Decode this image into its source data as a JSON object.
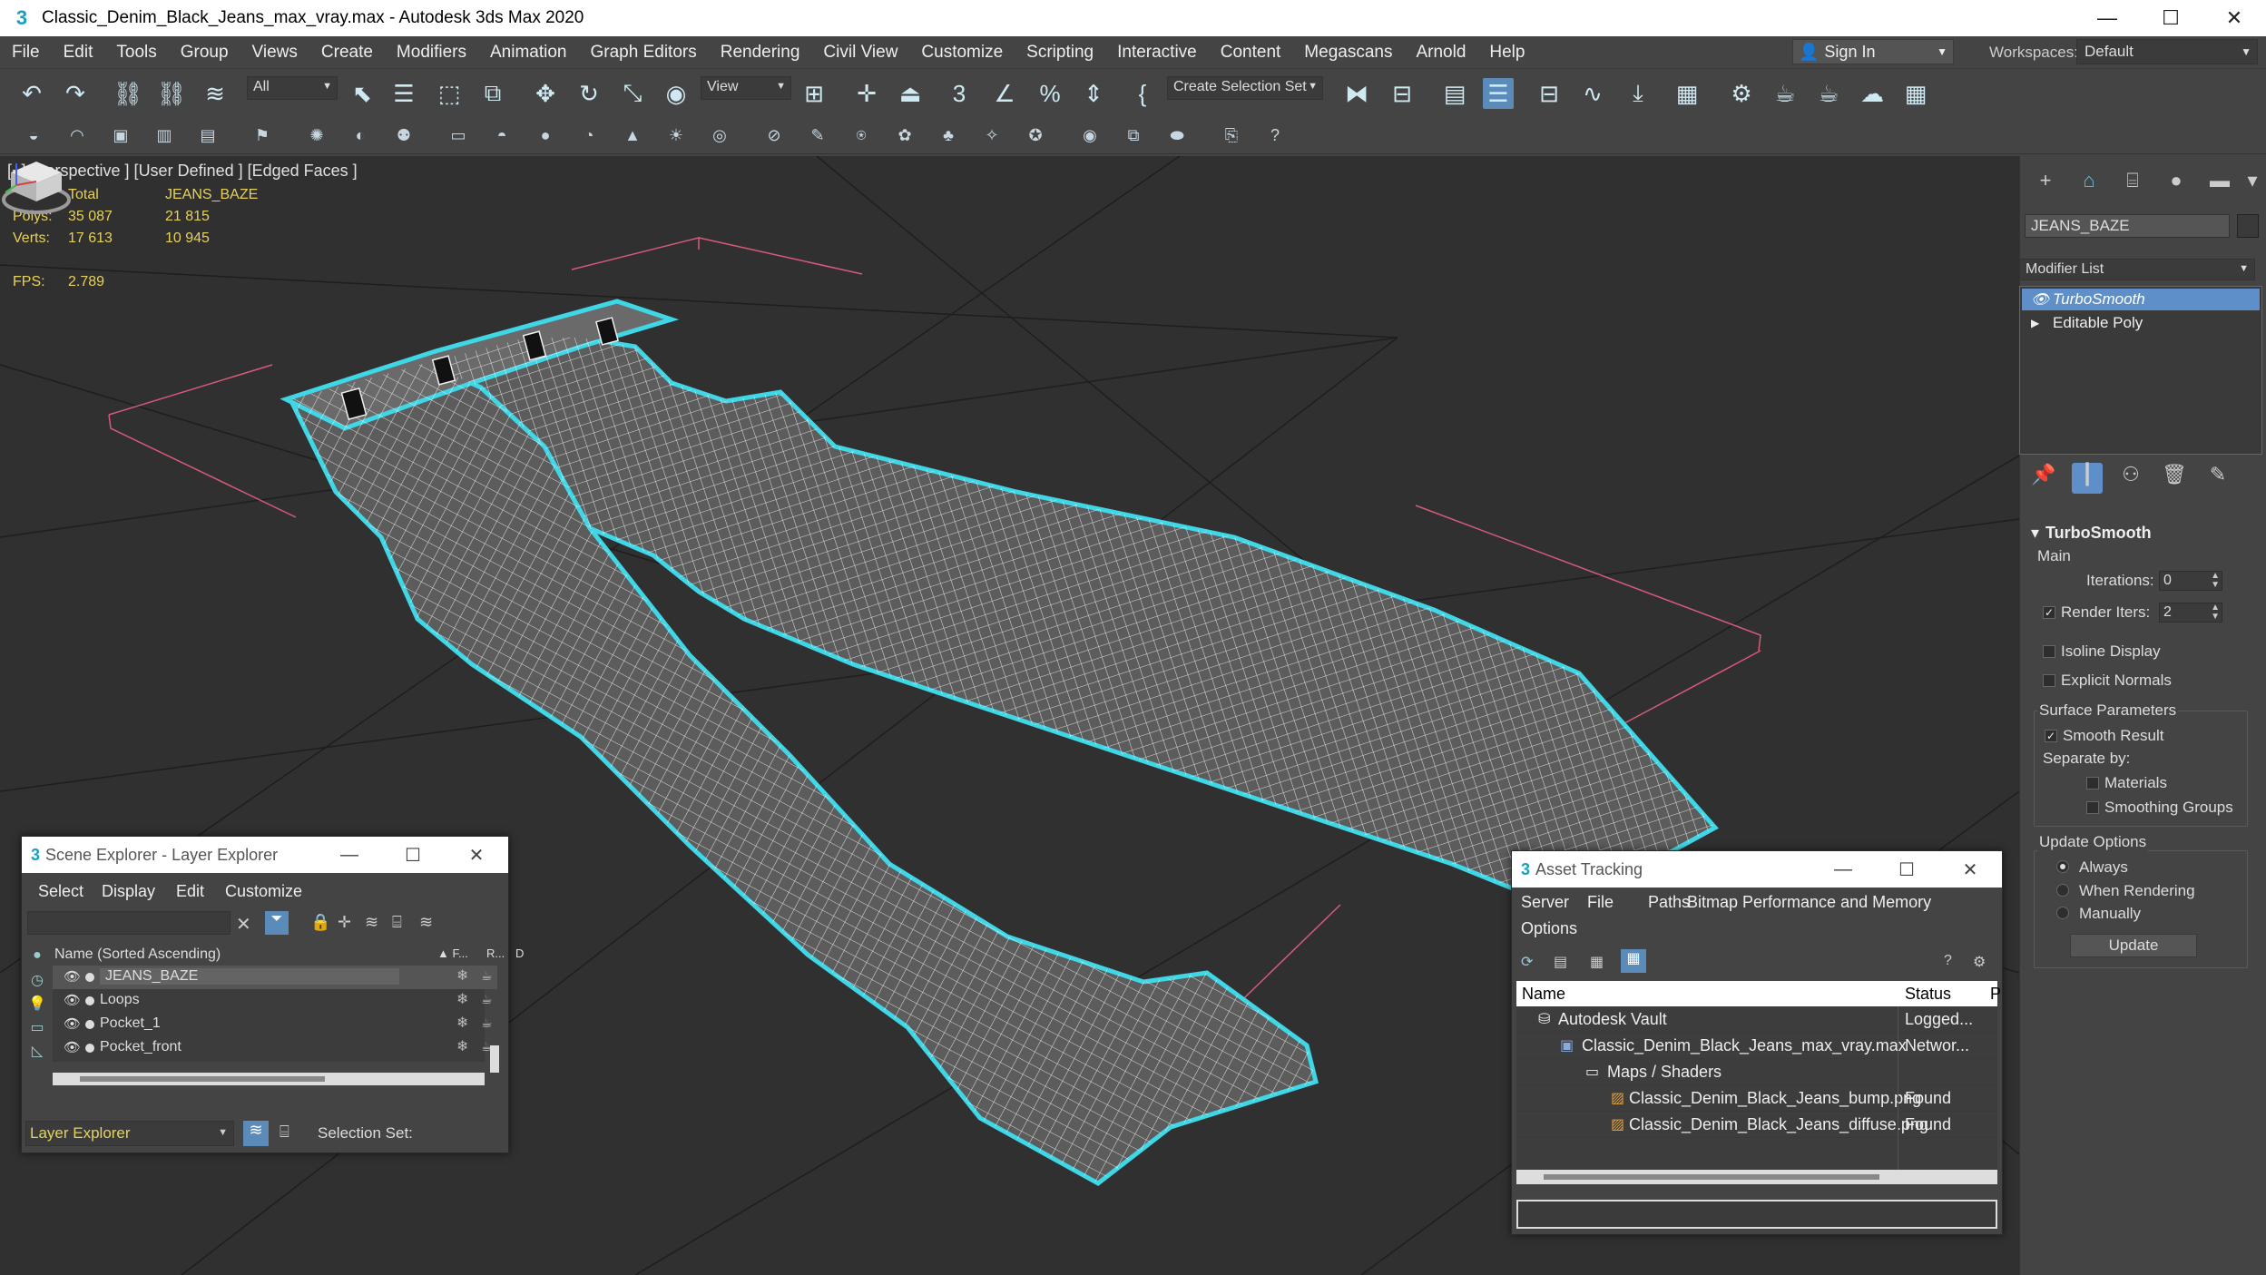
{
  "window": {
    "title": "Classic_Denim_Black_Jeans_max_vray.max - Autodesk 3ds Max 2020",
    "controls": [
      "—",
      "☐",
      "✕"
    ]
  },
  "menu": [
    "File",
    "Edit",
    "Tools",
    "Group",
    "Views",
    "Create",
    "Modifiers",
    "Animation",
    "Graph Editors",
    "Rendering",
    "Civil View",
    "Customize",
    "Scripting",
    "Interactive",
    "Content",
    "Megascans",
    "Arnold",
    "Help"
  ],
  "signin": "Sign In",
  "workspaces": {
    "label": "Workspaces:",
    "value": "Default"
  },
  "toolbar": {
    "filter_dropdown": "All",
    "view_dropdown": "View",
    "selection_set": "Create Selection Set"
  },
  "viewport": {
    "label": "[+] [Perspective ] [User Defined ] [Edged Faces ]",
    "stats": {
      "col_total": "Total",
      "col_object": "JEANS_BAZE",
      "polys_label": "Polys:",
      "polys_total": "35 087",
      "polys_object": "21 815",
      "verts_label": "Verts:",
      "verts_total": "17 613",
      "verts_object": "10 945",
      "fps_label": "FPS:",
      "fps_value": "2.789"
    },
    "wire_color": "#ffffff",
    "selection_color": "#3fd6e6",
    "grid_bbox_color": "#d85a7a"
  },
  "command_panel": {
    "object_name": "JEANS_BAZE",
    "modifier_list": "Modifier List",
    "stack": [
      {
        "label": "TurboSmooth",
        "selected": true,
        "icon": "eye-icon"
      },
      {
        "label": "Editable Poly",
        "selected": false,
        "icon": "expand-arrow-icon"
      }
    ],
    "turbosmooth": {
      "title": "TurboSmooth",
      "main": "Main",
      "iterations_label": "Iterations:",
      "iterations_value": "0",
      "render_iters_label": "Render Iters:",
      "render_iters_value": "2",
      "render_iters_checked": true,
      "isoline": "Isoline Display",
      "explicit_normals": "Explicit Normals",
      "surface_params": "Surface Parameters",
      "smooth_result": "Smooth Result",
      "separate_by": "Separate by:",
      "materials": "Materials",
      "smoothing_groups": "Smoothing Groups",
      "update_options": "Update Options",
      "always": "Always",
      "when_rendering": "When Rendering",
      "manually": "Manually",
      "update_button": "Update"
    }
  },
  "scene_explorer": {
    "title": "Scene Explorer - Layer Explorer",
    "menu": [
      "Select",
      "Display",
      "Edit",
      "Customize"
    ],
    "column_name": "Name (Sorted Ascending)",
    "column_f": "▲ F...",
    "column_r": "R...",
    "column_d": "D",
    "rows": [
      "JEANS_BAZE",
      "Loops",
      "Pocket_1",
      "Pocket_front"
    ],
    "footer_dropdown": "Layer Explorer",
    "selection_set_label": "Selection Set:"
  },
  "asset_tracking": {
    "title": "Asset Tracking",
    "menu": [
      "Server",
      "File",
      "Paths",
      "Bitmap Performance and Memory",
      "Options"
    ],
    "col_name": "Name",
    "col_status": "Status",
    "col_p": "P",
    "rows": [
      {
        "name": "Autodesk Vault",
        "status": "Logged...",
        "indent": 0,
        "icon": "vault-icon"
      },
      {
        "name": "Classic_Denim_Black_Jeans_max_vray.max",
        "status": "Networ...",
        "indent": 1,
        "icon": "max-file-icon"
      },
      {
        "name": "Maps / Shaders",
        "status": "",
        "indent": 2,
        "icon": "folder-icon"
      },
      {
        "name": "Classic_Denim_Black_Jeans_bump.png",
        "status": "Found",
        "indent": 3,
        "icon": "image-file-icon"
      },
      {
        "name": "Classic_Denim_Black_Jeans_diffuse.png",
        "status": "Found",
        "indent": 3,
        "icon": "image-file-icon"
      }
    ]
  }
}
